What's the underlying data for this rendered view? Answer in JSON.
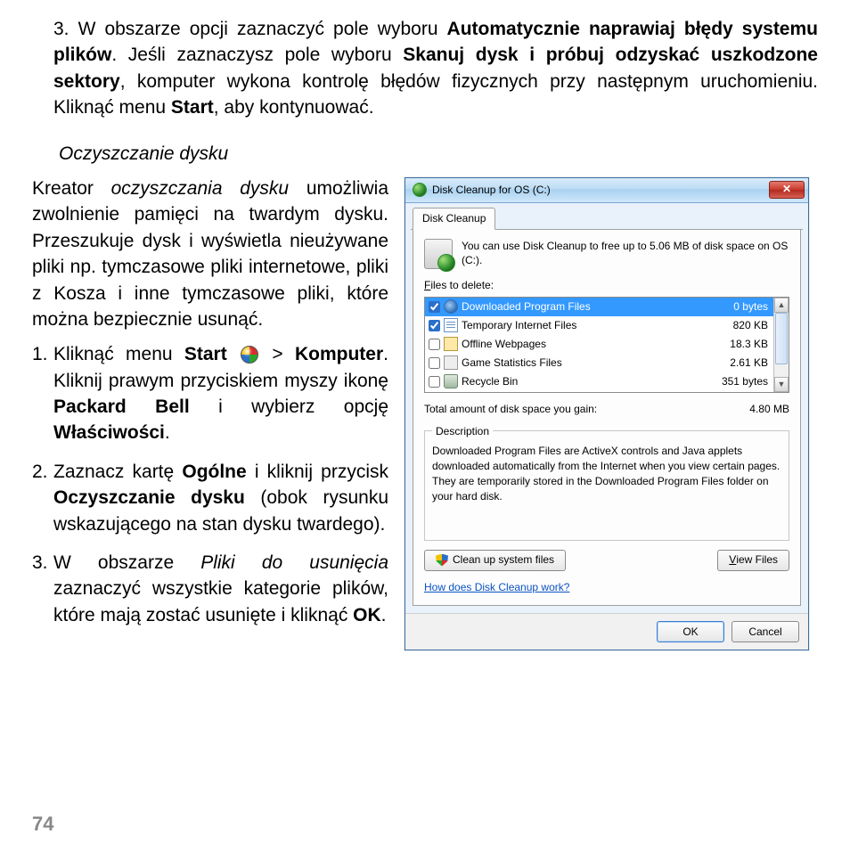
{
  "doc": {
    "step3": {
      "num": "3.",
      "t1": "W obszarze opcji zaznaczyć pole wyboru ",
      "b1": "Automatycznie naprawiaj błędy systemu plików",
      "t2": ". Jeśli zaznaczysz pole wyboru ",
      "b2": "Skanuj dysk i próbuj odzyskać uszkodzone sektory",
      "t3": ", komputer wykona kontrolę błędów fizycznych przy następnym uruchomieniu. Kliknąć menu ",
      "b3": "Start",
      "t4": ", aby kontynuować."
    },
    "subhead": "Oczyszczanie dysku",
    "intro": {
      "t1": "Kreator ",
      "i1": "oczyszczania dysku",
      "t2": " umożliwia zwolnienie pamięci na twardym dysku. Przeszukuje dysk i wyświetla nieużywane pliki np. tymczasowe pliki internetowe, pliki z Kosza i inne tymczasowe pliki, które można bezpiecznie usunąć."
    },
    "s1": {
      "n": "1.",
      "t1": "Kliknąć menu ",
      "b1": "Start",
      "t2": " > ",
      "b2": "Komputer",
      "t3": ". Kliknij prawym przyciskiem myszy ikonę ",
      "b3": "Packard Bell",
      "t4": " i wybierz opcję ",
      "b4": "Właściwości",
      "t5": "."
    },
    "s2": {
      "n": "2.",
      "t1": "Zaznacz kartę ",
      "b1": "Ogólne",
      "t2": " i kliknij przycisk ",
      "b2": "Oczyszczanie dysku",
      "t3": " (obok rysunku wskazującego na stan dysku twardego)."
    },
    "s3": {
      "n": "3.",
      "t1": "W obszarze ",
      "i1": "Pliki do usunięcia",
      "t2": " zaznaczyć wszystkie kategorie plików, które mają zostać usunięte i kliknąć ",
      "b1": "OK",
      "t3": "."
    },
    "page_num": "74"
  },
  "dlg": {
    "title": "Disk Cleanup for OS (C:)",
    "tab": "Disk Cleanup",
    "headtxt": "You can use Disk Cleanup to free up to 5.06 MB of disk space on OS (C:).",
    "files_label_pre": "F",
    "files_label": "iles to delete:",
    "rows": [
      {
        "checked": true,
        "sel": true,
        "name": "Downloaded Program Files",
        "size": "0 bytes",
        "icon": "globe"
      },
      {
        "checked": true,
        "sel": false,
        "name": "Temporary Internet Files",
        "size": "820 KB",
        "icon": "page"
      },
      {
        "checked": false,
        "sel": false,
        "name": "Offline Webpages",
        "size": "18.3 KB",
        "icon": "offl"
      },
      {
        "checked": false,
        "sel": false,
        "name": "Game Statistics Files",
        "size": "2.61 KB",
        "icon": "stat"
      },
      {
        "checked": false,
        "sel": false,
        "name": "Recycle Bin",
        "size": "351 bytes",
        "icon": "bin"
      }
    ],
    "total_label": "Total amount of disk space you gain:",
    "total_value": "4.80 MB",
    "desc_legend": "Description",
    "desc_text": "Downloaded Program Files are ActiveX controls and Java applets downloaded automatically from the Internet when you view certain pages. They are temporarily stored in the Downloaded Program Files folder on your hard disk.",
    "cleanup_btn": "Clean up system files",
    "view_btn_pre": "V",
    "view_btn": "iew Files",
    "link": "How does Disk Cleanup work?",
    "ok": "OK",
    "cancel": "Cancel"
  }
}
